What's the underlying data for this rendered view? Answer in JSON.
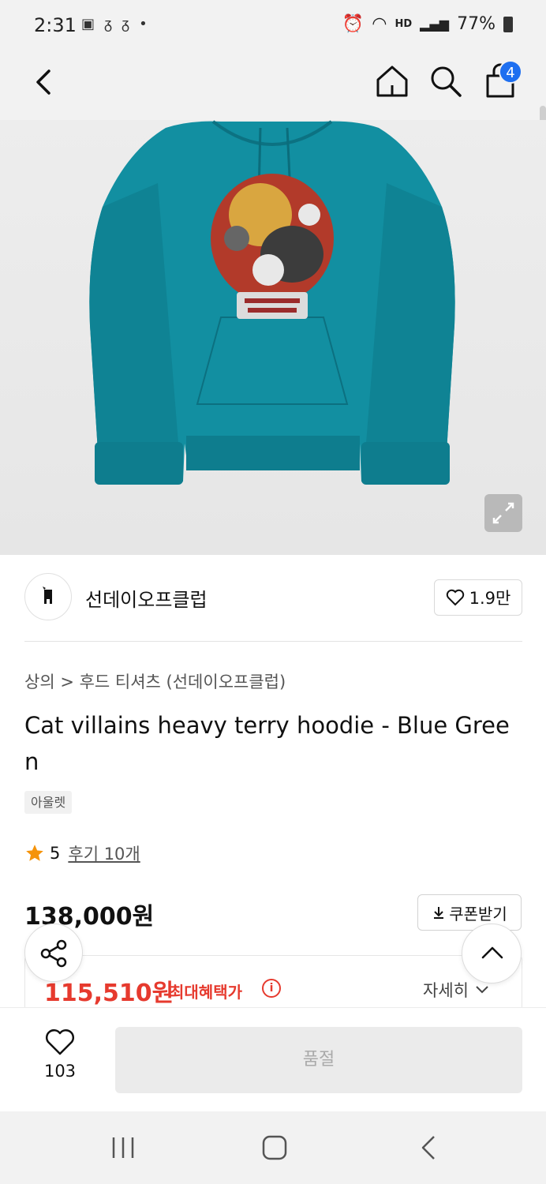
{
  "status_bar": {
    "time": "2:31",
    "battery": "77%",
    "network": "HD"
  },
  "header": {
    "cart_count": "4"
  },
  "brand": {
    "name": "선데이오프클럽",
    "likes": "1.9만"
  },
  "product": {
    "breadcrumb": "상의 > 후드 티셔츠 (선데이오프클럽)",
    "title": "Cat villains heavy terry hoodie - Blue Green",
    "tag": "아울렛",
    "rating": "5",
    "review_link": "후기 10개",
    "price": "138,000원",
    "coupon_label": "쿠폰받기",
    "benefit_price": "115,510원",
    "benefit_label": "최대혜택가",
    "benefit_detail": "자세히",
    "hoodie_color": "#128fa1"
  },
  "bottom_bar": {
    "wish_count": "103",
    "soldout_label": "품절"
  }
}
